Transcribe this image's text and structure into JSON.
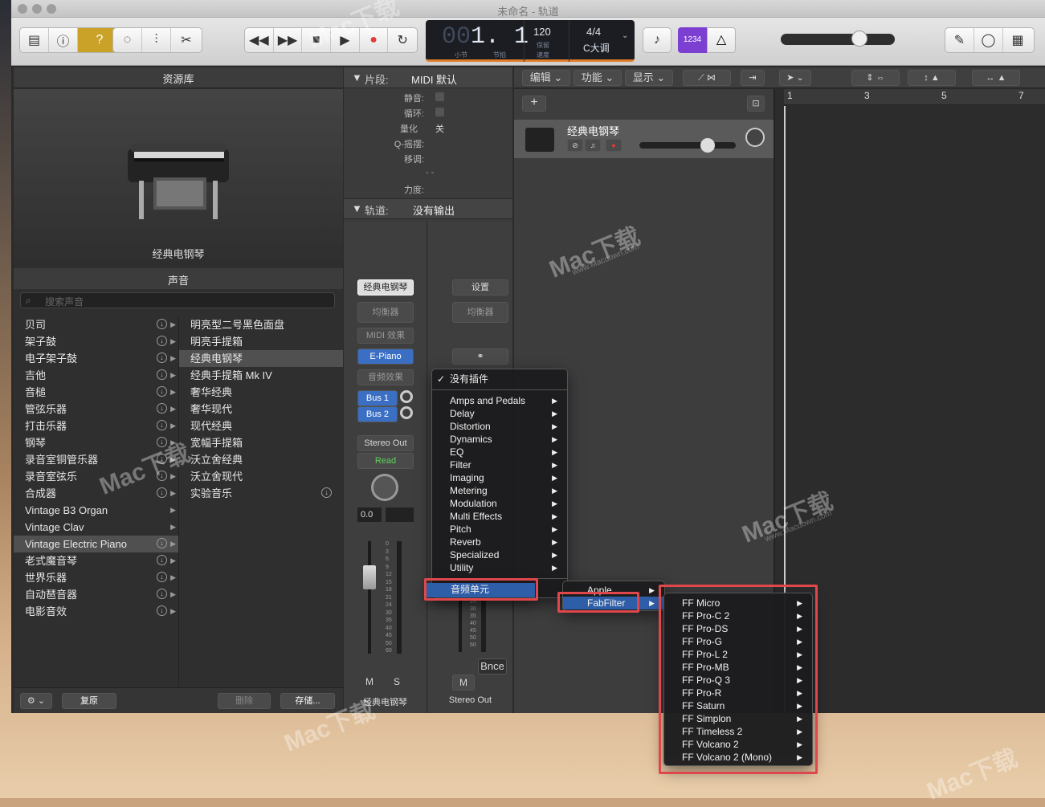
{
  "window": {
    "title": "未命名 - 轨道"
  },
  "toolbar": {
    "lcd": {
      "bar_dim": "00",
      "bar_value": "1. 1",
      "bar_label": "小节",
      "beat_label": "节拍",
      "tempo": "120",
      "tempo_label1": "保留",
      "tempo_label2": "速度",
      "time_sig": "4/4",
      "key": "C大调"
    },
    "count_in": "1234"
  },
  "library": {
    "header": "资源库",
    "patch_name": "经典电钢琴",
    "sounds_header": "声音",
    "search_placeholder": "搜索声音",
    "categories": [
      "贝司",
      "架子鼓",
      "电子架子鼓",
      "吉他",
      "音槌",
      "管弦乐器",
      "打击乐器",
      "钢琴",
      "录音室铜管乐器",
      "录音室弦乐",
      "合成器",
      "Vintage B3 Organ",
      "Vintage Clav",
      "Vintage Electric Piano",
      "老式魔音琴",
      "世界乐器",
      "自动琶音器",
      "电影音效"
    ],
    "patches": [
      "明亮型二号黑色面盘",
      "明亮手提箱",
      "经典电钢琴",
      "经典手提箱 Mk IV",
      "奢华经典",
      "奢华现代",
      "现代经典",
      "宽幅手提箱",
      "沃立舍经典",
      "沃立舍现代",
      "实验音乐"
    ],
    "footer": {
      "restore": "复原",
      "delete": "删除",
      "save": "存储..."
    }
  },
  "inspector": {
    "region_header": "片段:",
    "region_name": "MIDI 默认",
    "props": {
      "mute": "静音:",
      "loop": "循环:",
      "quantize": "量化",
      "quantize_val": "关",
      "qswing": "Q-摇摆:",
      "transpose": "移调:",
      "dashes": "- -",
      "velocity": "力度:"
    },
    "track_header": "轨道:",
    "track_output": "没有输出"
  },
  "channel1": {
    "setting": "经典电钢琴",
    "eq": "均衡器",
    "midi_fx": "MIDI 效果",
    "instrument": "E-Piano",
    "audio_fx": "音频效果",
    "bus1": "Bus 1",
    "bus2": "Bus 2",
    "output": "Stereo Out",
    "automation": "Read",
    "volume": "0.0",
    "mute": "M",
    "solo": "S",
    "name": "经典电钢琴"
  },
  "channel2": {
    "setting": "设置",
    "eq": "均衡器",
    "bounce": "Bnce",
    "mute": "M",
    "name": "Stereo Out"
  },
  "scale_marks": [
    "0",
    "3",
    "6",
    "9",
    "12",
    "15",
    "18",
    "21",
    "24",
    "30",
    "35",
    "40",
    "45",
    "50",
    "60"
  ],
  "tracks_area": {
    "menus": [
      "编辑",
      "功能",
      "显示"
    ],
    "track_name": "经典电钢琴",
    "ruler": [
      "1",
      "3",
      "5",
      "7"
    ]
  },
  "plugin_menu": {
    "no_plugin": "没有插件",
    "items": [
      "Amps and Pedals",
      "Delay",
      "Distortion",
      "Dynamics",
      "EQ",
      "Filter",
      "Imaging",
      "Metering",
      "Modulation",
      "Multi Effects",
      "Pitch",
      "Reverb",
      "Specialized",
      "Utility"
    ],
    "audio_units": "音频单元"
  },
  "vendor_menu": {
    "items": [
      "Apple",
      "FabFilter"
    ]
  },
  "fabfilter_menu": {
    "items": [
      "FF Micro",
      "FF Pro-C 2",
      "FF Pro-DS",
      "FF Pro-G",
      "FF Pro-L 2",
      "FF Pro-MB",
      "FF Pro-Q 3",
      "FF Pro-R",
      "FF Saturn",
      "FF Simplon",
      "FF Timeless 2",
      "FF Volcano 2",
      "FF Volcano 2 (Mono)"
    ]
  },
  "watermark": {
    "brand": "Mac下载",
    "url": "www.Macdown.com"
  },
  "colors": {
    "accent_blue": "#2f5ea8",
    "highlight_red": "#e0474b",
    "lcd_orange": "#e07d2b",
    "count_in_purple": "#7b3fd1"
  }
}
